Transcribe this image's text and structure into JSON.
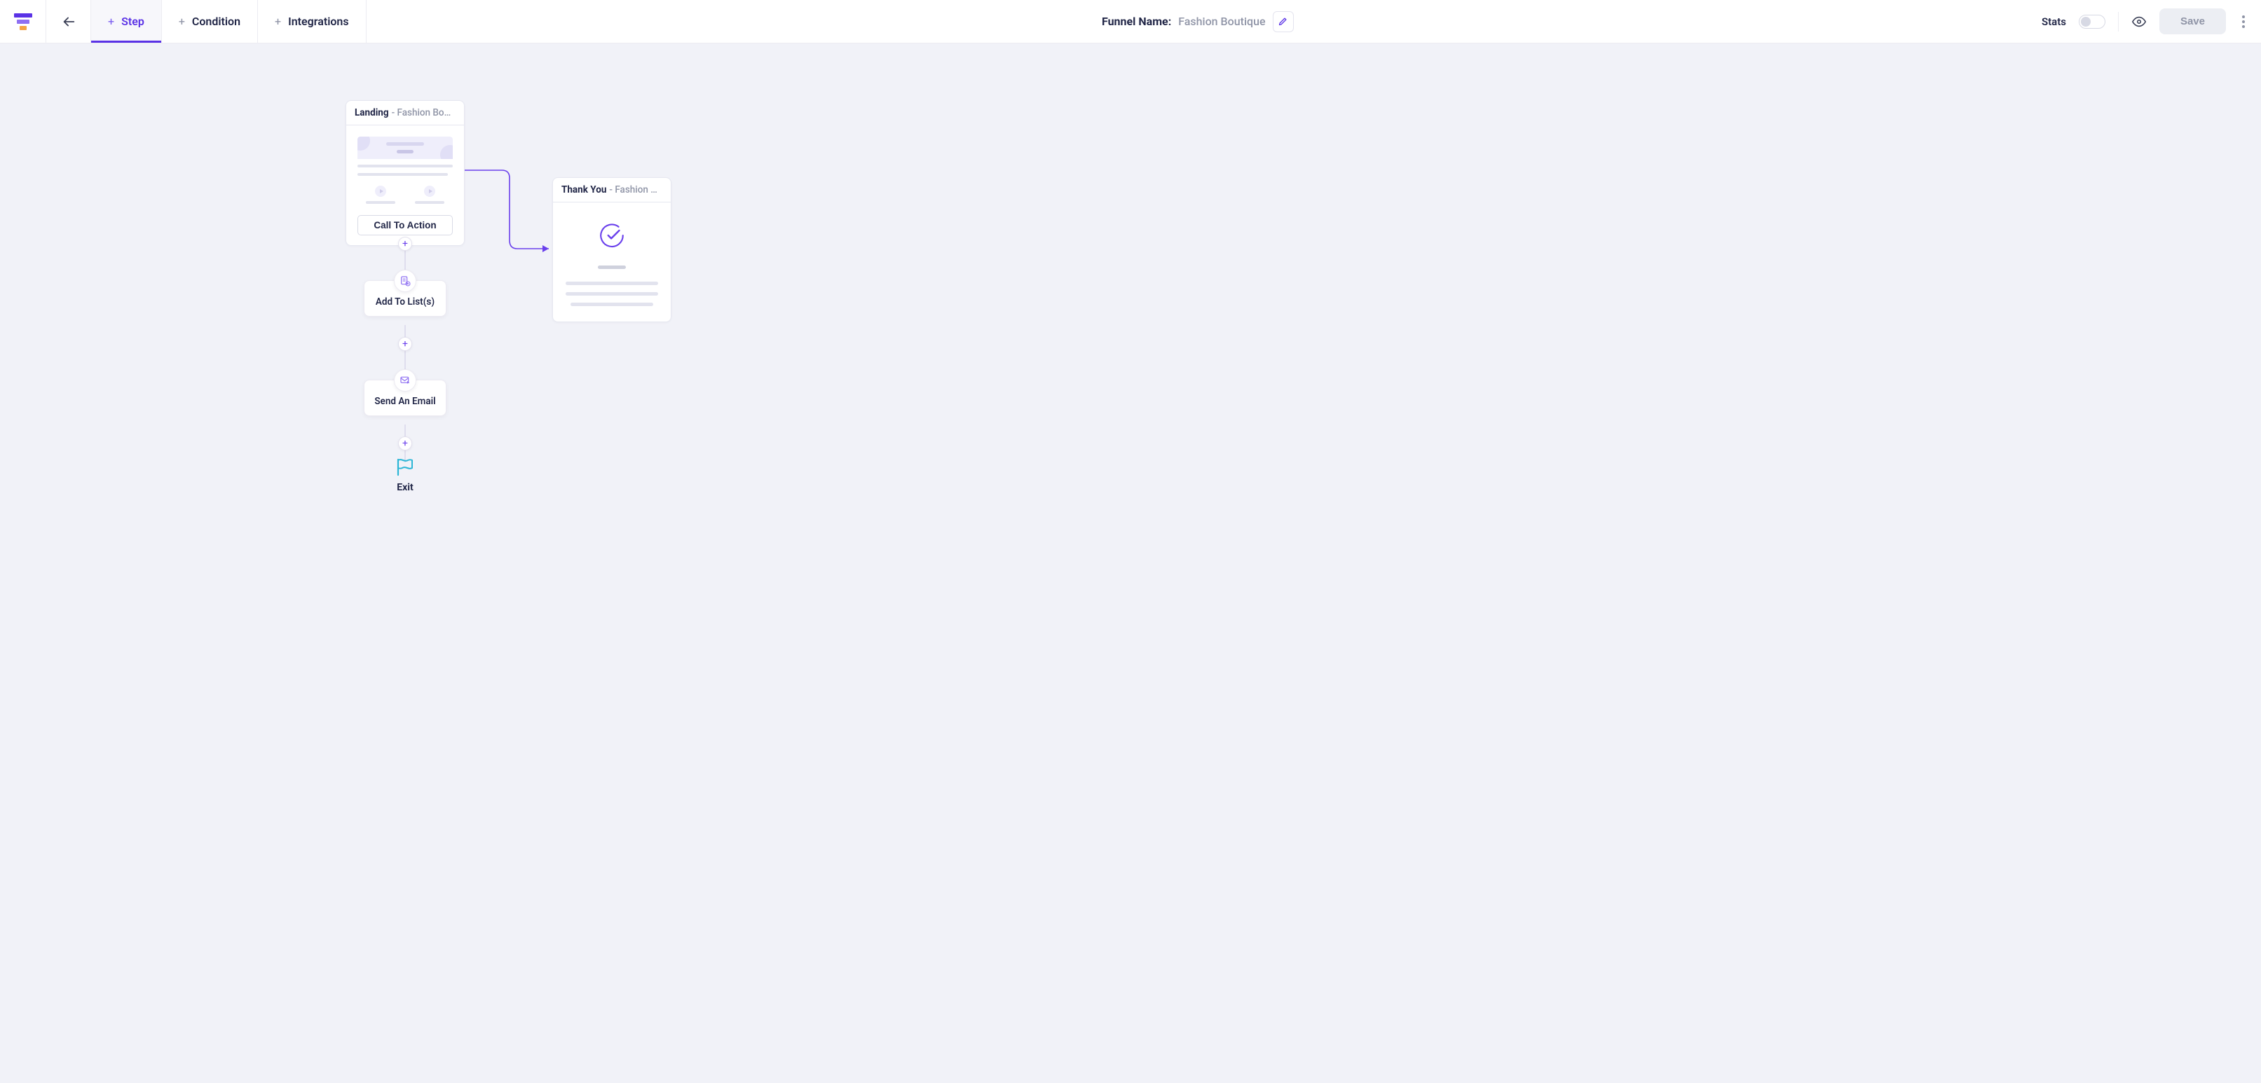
{
  "toolbar": {
    "tabs": {
      "step": "Step",
      "condition": "Condition",
      "integrations": "Integrations"
    },
    "funnel_name_label": "Funnel Name:",
    "funnel_name_value": "Fashion Boutique",
    "stats_label": "Stats",
    "save_label": "Save"
  },
  "canvas": {
    "landing": {
      "title": "Landing",
      "subtitle": "- Fashion Boutiq…",
      "cta_label": "Call To Action"
    },
    "thankyou": {
      "title": "Thank You",
      "subtitle": "- Fashion Boutiq…"
    },
    "action_add_to_list": "Add To List(s)",
    "action_send_email": "Send An Email",
    "exit_label": "Exit"
  }
}
